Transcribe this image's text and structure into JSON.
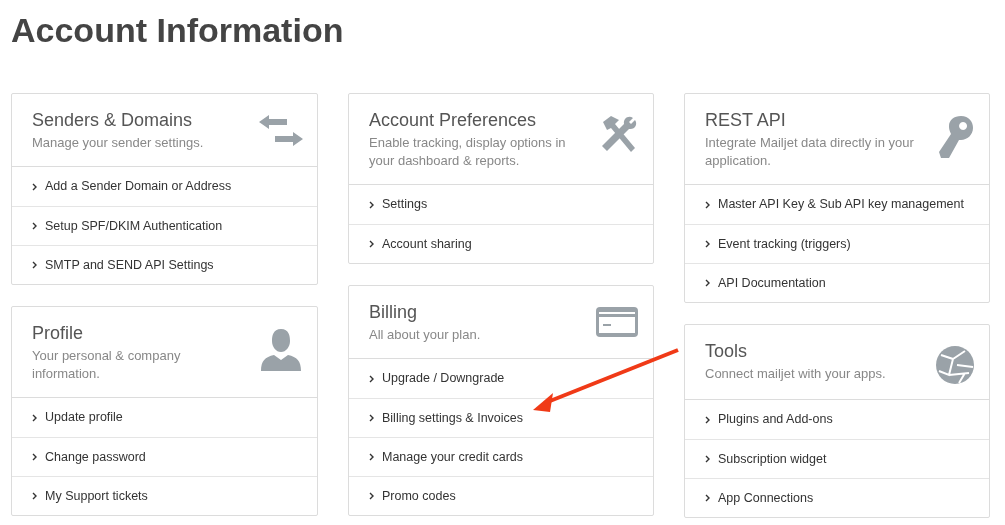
{
  "page_title": "Account Information",
  "columns": [
    {
      "cards": [
        {
          "title": "Senders & Domains",
          "description": "Manage your sender settings.",
          "links": [
            "Add a Sender Domain or Address",
            "Setup SPF/DKIM Authentication",
            "SMTP and SEND API Settings"
          ]
        },
        {
          "title": "Profile",
          "description": "Your personal & company information.",
          "links": [
            "Update profile",
            "Change password",
            "My Support tickets"
          ]
        }
      ]
    },
    {
      "cards": [
        {
          "title": "Account Preferences",
          "description": "Enable tracking, display options in your dashboard & reports.",
          "links": [
            "Settings",
            "Account sharing"
          ]
        },
        {
          "title": "Billing",
          "description": "All about your plan.",
          "links": [
            "Upgrade / Downgrade",
            "Billing settings & Invoices",
            "Manage your credit cards",
            "Promo codes"
          ]
        }
      ]
    },
    {
      "cards": [
        {
          "title": "REST API",
          "description": "Integrate Mailjet data directly in your application.",
          "links": [
            "Master API Key & Sub API key management",
            "Event tracking (triggers)",
            "API Documentation"
          ]
        },
        {
          "title": "Tools",
          "description": "Connect mailjet with your apps.",
          "links": [
            "Plugins and Add-ons",
            "Subscription widget",
            "App Connections"
          ]
        }
      ]
    }
  ]
}
